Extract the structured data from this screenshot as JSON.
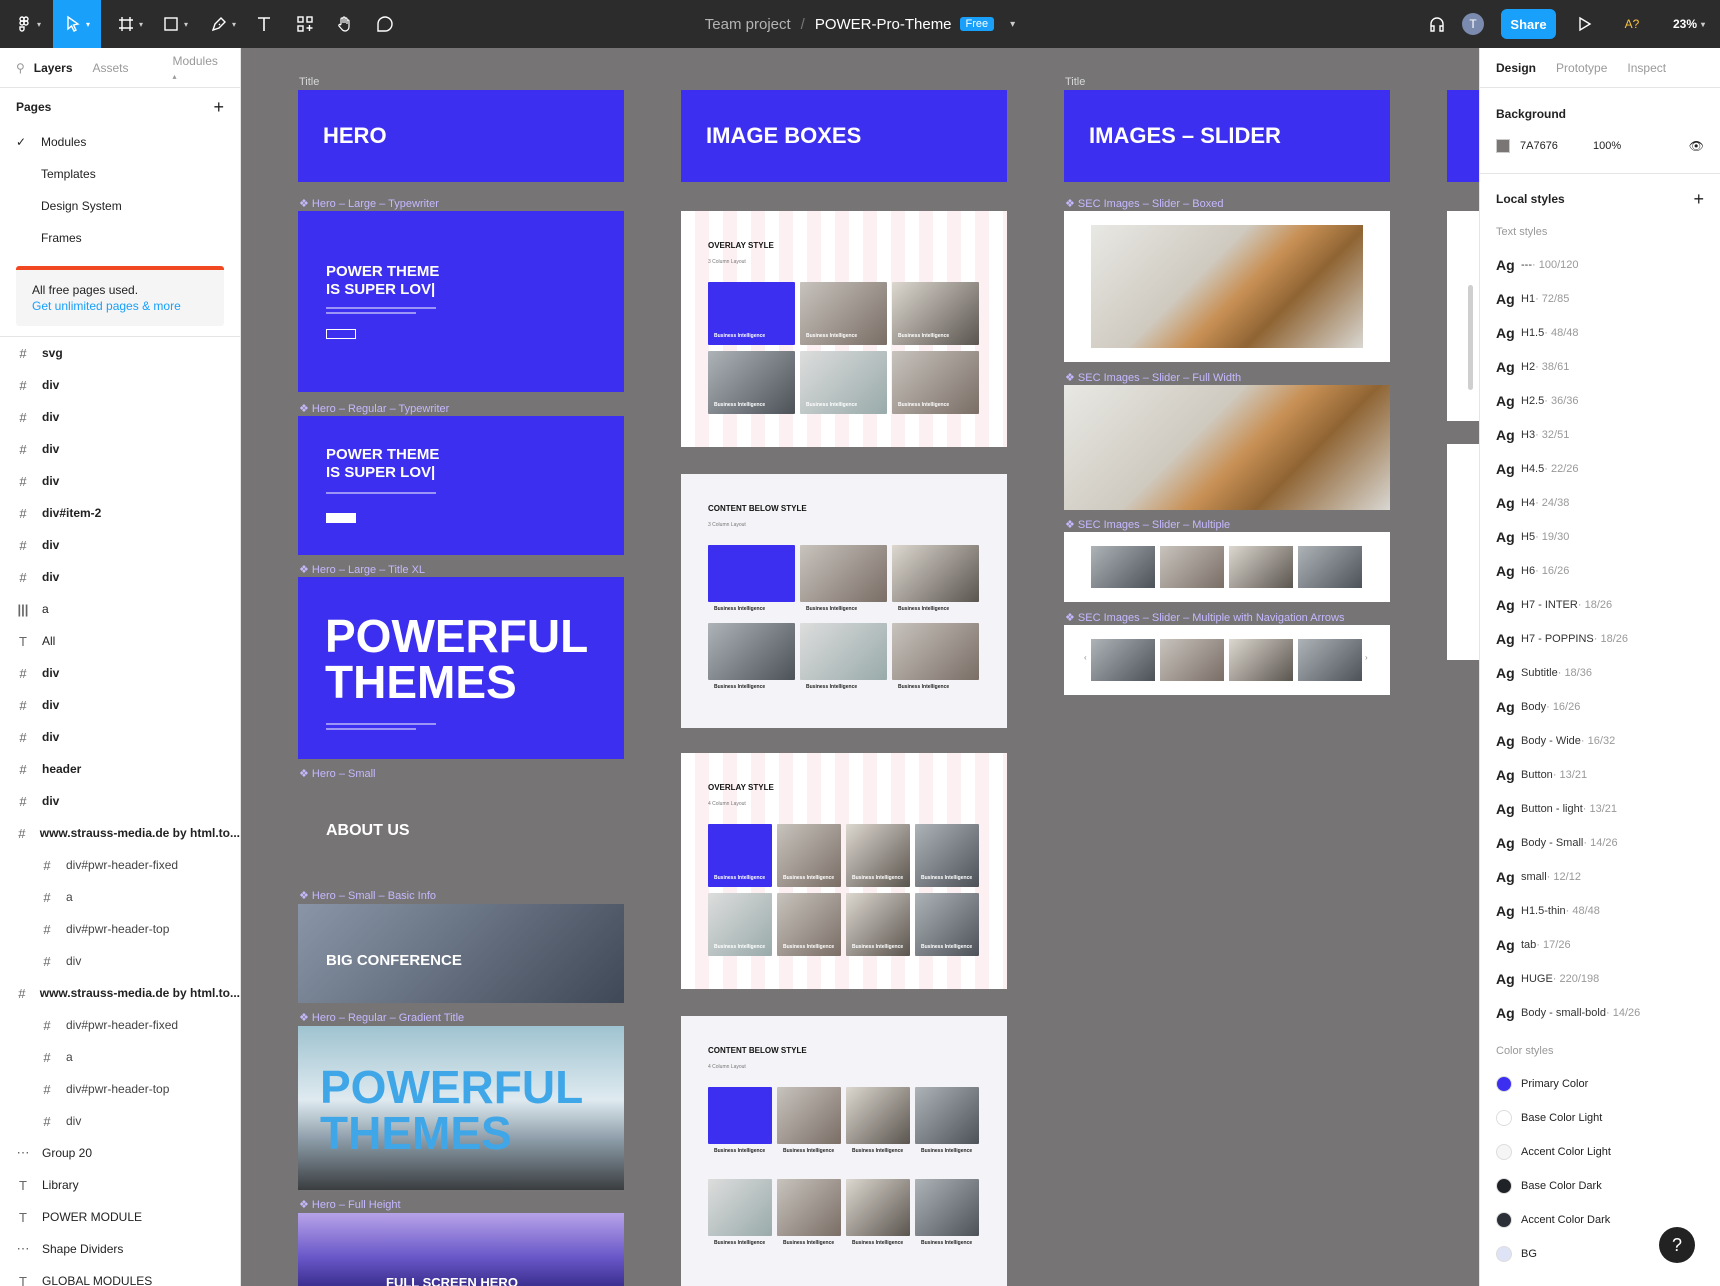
{
  "toolbar": {
    "project": "Team project",
    "file": "POWER-Pro-Theme",
    "plan": "Free",
    "share": "Share",
    "avatar": "T",
    "warning": "A?",
    "zoom": "23%"
  },
  "left_panel": {
    "tabs": [
      "Layers",
      "Assets",
      "Modules"
    ],
    "pages_label": "Pages",
    "pages": [
      "Modules",
      "Templates",
      "Design System",
      "Frames"
    ],
    "notice_text": "All free pages used.",
    "notice_link": "Get unlimited pages & more",
    "layers": [
      {
        "icon": "#",
        "name": "svg",
        "indent": 0
      },
      {
        "icon": "#",
        "name": "div",
        "indent": 0
      },
      {
        "icon": "#",
        "name": "div",
        "indent": 0
      },
      {
        "icon": "#",
        "name": "div",
        "indent": 0
      },
      {
        "icon": "#",
        "name": "div",
        "indent": 0
      },
      {
        "icon": "#",
        "name": "div#item-2",
        "indent": 0
      },
      {
        "icon": "#",
        "name": "div",
        "indent": 0
      },
      {
        "icon": "#",
        "name": "div",
        "indent": 0
      },
      {
        "icon": "|||",
        "name": "a",
        "indent": 0
      },
      {
        "icon": "T",
        "name": "All",
        "indent": 0
      },
      {
        "icon": "#",
        "name": "div",
        "indent": 0
      },
      {
        "icon": "#",
        "name": "div",
        "indent": 0
      },
      {
        "icon": "#",
        "name": "div",
        "indent": 0
      },
      {
        "icon": "#",
        "name": "header",
        "indent": 0
      },
      {
        "icon": "#",
        "name": "div",
        "indent": 0
      },
      {
        "icon": "#",
        "name": "www.strauss-media.de by html.to...",
        "indent": 0
      },
      {
        "icon": "#",
        "name": "div#pwr-header-fixed",
        "indent": 1
      },
      {
        "icon": "#",
        "name": "a",
        "indent": 1
      },
      {
        "icon": "#",
        "name": "div#pwr-header-top",
        "indent": 1
      },
      {
        "icon": "#",
        "name": "div",
        "indent": 1
      },
      {
        "icon": "#",
        "name": "www.strauss-media.de by html.to...",
        "indent": 0
      },
      {
        "icon": "#",
        "name": "div#pwr-header-fixed",
        "indent": 1
      },
      {
        "icon": "#",
        "name": "a",
        "indent": 1
      },
      {
        "icon": "#",
        "name": "div#pwr-header-top",
        "indent": 1
      },
      {
        "icon": "#",
        "name": "div",
        "indent": 1
      },
      {
        "icon": "⋯",
        "name": "Group 20",
        "indent": 0
      },
      {
        "icon": "T",
        "name": "Library",
        "indent": 0
      },
      {
        "icon": "T",
        "name": "POWER MODULE",
        "indent": 0
      },
      {
        "icon": "⋯",
        "name": "Shape Dividers",
        "indent": 0
      },
      {
        "icon": "T",
        "name": "GLOBAL MODULES",
        "indent": 0
      }
    ]
  },
  "right_panel": {
    "tabs": [
      "Design",
      "Prototype",
      "Inspect"
    ],
    "background_label": "Background",
    "bg_hex": "7A7676",
    "bg_opacity": "100%",
    "bg_color": "#7a7676",
    "local_styles": "Local styles",
    "text_styles_label": "Text styles",
    "text_styles": [
      {
        "name": "---",
        "size": "100/120"
      },
      {
        "name": "H1",
        "size": "72/85"
      },
      {
        "name": "H1.5",
        "size": "48/48"
      },
      {
        "name": "H2",
        "size": "38/61"
      },
      {
        "name": "H2.5",
        "size": "36/36"
      },
      {
        "name": "H3",
        "size": "32/51"
      },
      {
        "name": "H4.5",
        "size": "22/26"
      },
      {
        "name": "H4",
        "size": "24/38"
      },
      {
        "name": "H5",
        "size": "19/30"
      },
      {
        "name": "H6",
        "size": "16/26"
      },
      {
        "name": "H7 - INTER",
        "size": "18/26"
      },
      {
        "name": "H7 - POPPINS",
        "size": "18/26"
      },
      {
        "name": "Subtitle",
        "size": "18/36"
      },
      {
        "name": "Body",
        "size": "16/26"
      },
      {
        "name": "Body - Wide",
        "size": "16/32"
      },
      {
        "name": "Button",
        "size": "13/21"
      },
      {
        "name": "Button - light",
        "size": "13/21"
      },
      {
        "name": "Body - Small",
        "size": "14/26"
      },
      {
        "name": "small",
        "size": "12/12"
      },
      {
        "name": "H1.5-thin",
        "size": "48/48"
      },
      {
        "name": "tab",
        "size": "17/26"
      },
      {
        "name": "HUGE",
        "size": "220/198"
      },
      {
        "name": "Body - small-bold",
        "size": "14/26"
      }
    ],
    "color_styles_label": "Color styles",
    "color_styles": [
      {
        "name": "Primary Color",
        "color": "#3c2fef"
      },
      {
        "name": "Base Color Light",
        "color": "#ffffff"
      },
      {
        "name": "Accent Color Light",
        "color": "#f5f5f5"
      },
      {
        "name": "Base Color Dark",
        "color": "#1f2226"
      },
      {
        "name": "Accent Color Dark",
        "color": "#2b2f36"
      },
      {
        "name": "BG",
        "color": "#dfe3f6"
      }
    ]
  },
  "canvas": {
    "title_label": "Title",
    "col1": {
      "banner": "HERO",
      "labels": [
        "Hero – Large – Typewriter",
        "Hero – Regular – Typewriter",
        "Hero – Large – Title XL",
        "Hero – Small",
        "Hero – Small – Basic Info",
        "Hero – Regular – Gradient Title",
        "Hero – Full Height"
      ],
      "typewriter_text": "POWER THEME\nIS SUPER LOV|",
      "xl_text": "POWERFUL\nTHEMES",
      "about": "ABOUT US",
      "conference": "BIG CONFERENCE",
      "gradient_text": "POWERFUL\nTHEMES",
      "full_height": "FULL SCREEN HERO"
    },
    "col2": {
      "banner": "IMAGE BOXES",
      "frames": [
        "OVERLAY STYLE",
        "CONTENT BELOW STYLE",
        "OVERLAY STYLE",
        "CONTENT BELOW STYLE"
      ],
      "card_caption": "Business Intelligence"
    },
    "col3": {
      "banner": "IMAGES – SLIDER",
      "labels": [
        "SEC Images – Slider – Boxed",
        "SEC Images – Slider – Full Width",
        "SEC Images – Slider – Multiple",
        "SEC Images – Slider – Multiple with Navigation Arrows"
      ]
    }
  }
}
